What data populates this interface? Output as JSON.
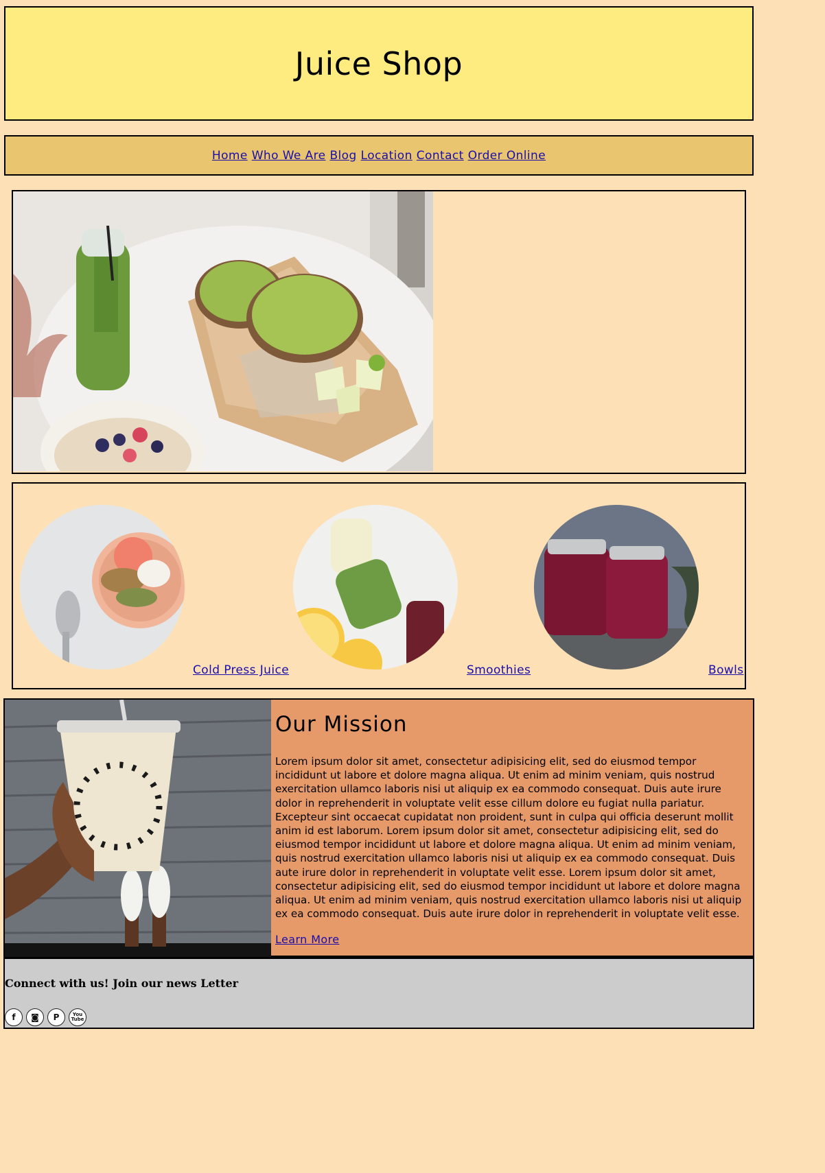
{
  "header": {
    "title": "Juice Shop"
  },
  "nav": {
    "items": [
      "Home",
      "Who We Are",
      "Blog",
      "Location",
      "Contact",
      "Order Online"
    ]
  },
  "products": {
    "links": [
      "Cold Press Juice",
      "Smoothies",
      "Bowls"
    ]
  },
  "mission": {
    "title": "Our Mission",
    "body": "Lorem ipsum dolor sit amet, consectetur adipisicing elit, sed do eiusmod tempor incididunt ut labore et dolore magna aliqua. Ut enim ad minim veniam, quis nostrud exercitation ullamco laboris nisi ut aliquip ex ea commodo consequat. Duis aute irure dolor in reprehenderit in voluptate velit esse cillum dolore eu fugiat nulla pariatur. Excepteur sint occaecat cupidatat non proident, sunt in culpa qui officia deserunt mollit anim id est laborum. Lorem ipsum dolor sit amet, consectetur adipisicing elit, sed do eiusmod tempor incididunt ut labore et dolore magna aliqua. Ut enim ad minim veniam, quis nostrud exercitation ullamco laboris nisi ut aliquip ex ea commodo consequat. Duis aute irure dolor in reprehenderit in voluptate velit esse. Lorem ipsum dolor sit amet, consectetur adipisicing elit, sed do eiusmod tempor incididunt ut labore et dolore magna aliqua. Ut enim ad minim veniam, quis nostrud exercitation ullamco laboris nisi ut aliquip ex ea commodo consequat. Duis aute irure dolor in reprehenderit in voluptate velit esse.",
    "link": "Learn More"
  },
  "footer": {
    "heading": "Connect with us! Join our news Letter",
    "social": [
      {
        "icon": "facebook-icon",
        "glyph": "f"
      },
      {
        "icon": "instagram-icon",
        "glyph": "◙"
      },
      {
        "icon": "pinterest-icon",
        "glyph": "P"
      },
      {
        "icon": "youtube-icon",
        "glyph": "You Tube"
      }
    ]
  },
  "colors": {
    "page_bg": "#fde0b6",
    "header_bg": "#ffec80",
    "nav_bg": "#eac56f",
    "mission_bg": "#e69a6a",
    "footer_bg": "#cccccc",
    "link": "#1a0dab"
  }
}
